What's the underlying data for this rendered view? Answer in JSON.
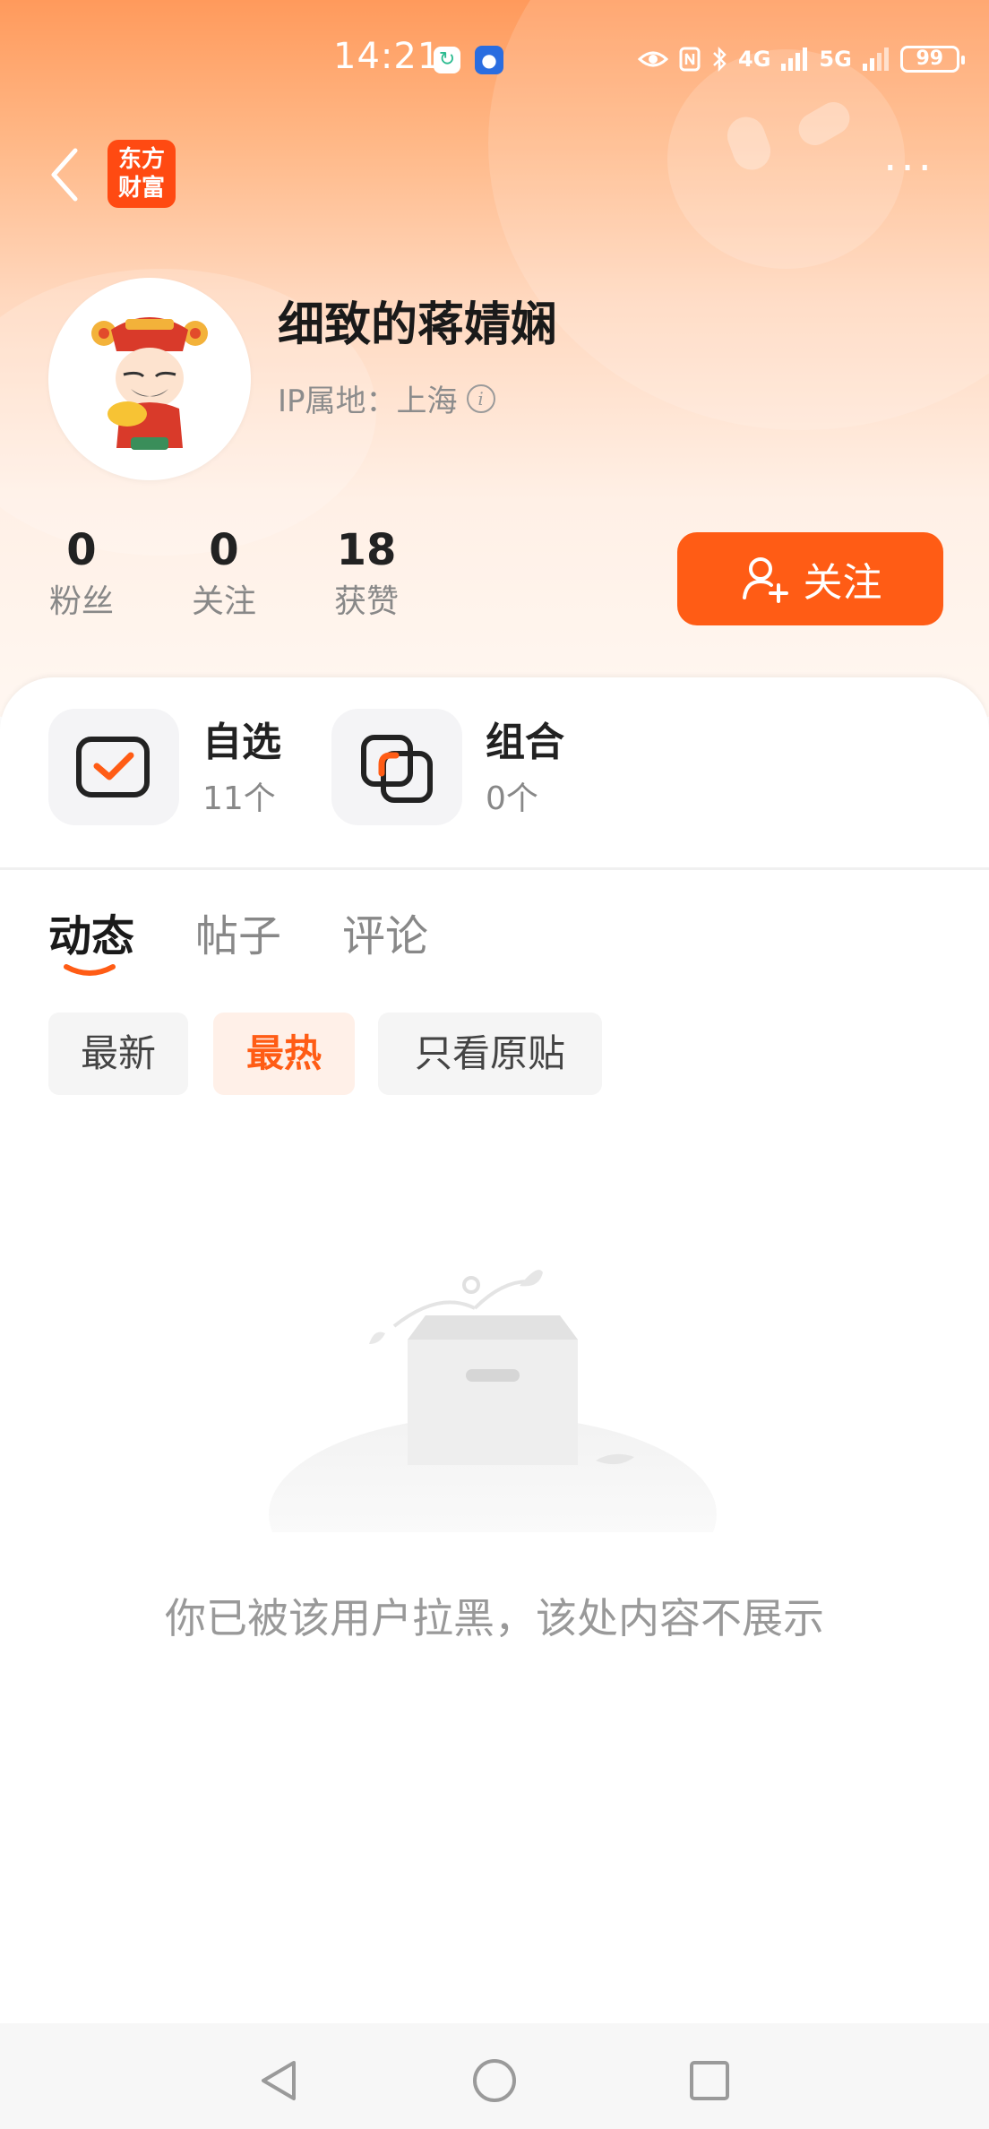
{
  "status_bar": {
    "time": "14:21",
    "network_4g": "4G",
    "network_5g": "5G",
    "battery": "99"
  },
  "nav": {
    "logo_line1": "东方",
    "logo_line2": "财富",
    "more": "···"
  },
  "profile": {
    "name": "细致的蒋婧娴",
    "ip_label": "IP属地：上海",
    "stats": [
      {
        "value": "0",
        "label": "粉丝"
      },
      {
        "value": "0",
        "label": "关注"
      },
      {
        "value": "18",
        "label": "获赞"
      }
    ],
    "follow_button": "关注"
  },
  "tiles": [
    {
      "title": "自选",
      "count": "11个"
    },
    {
      "title": "组合",
      "count": "0个"
    }
  ],
  "tabs": [
    "动态",
    "帖子",
    "评论"
  ],
  "filters": [
    "最新",
    "最热",
    "只看原贴"
  ],
  "empty_message": "你已被该用户拉黑，该处内容不展示",
  "colors": {
    "accent": "#ff5c15",
    "hero_top": "#ff9a5c"
  }
}
